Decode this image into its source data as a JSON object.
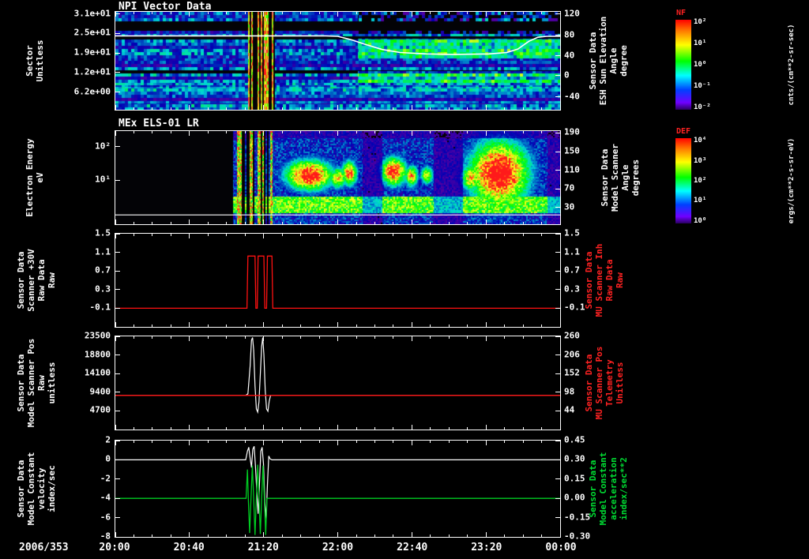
{
  "chart_data": {
    "type": "multi-panel-time-series",
    "date_label": "2006/353",
    "x_ticks": [
      "20:00",
      "20:40",
      "21:20",
      "22:00",
      "22:40",
      "23:20",
      "00:00"
    ],
    "panels": [
      {
        "title": "NPI Vector Data",
        "type": "spectrogram",
        "left_label": "Sector\nUnitless",
        "left_ticks": {
          "labels": [
            "3.1e+01",
            "2.5e+01",
            "1.9e+01",
            "1.2e+01",
            "6.2e+00"
          ],
          "fracs": [
            0.02,
            0.22,
            0.42,
            0.62,
            0.82
          ]
        },
        "right_label": "Sensor Data\nESH Sun Elevation\nAngle\ndegree",
        "right_ticks": {
          "labels": [
            "120",
            "80",
            "40",
            "0",
            "-40"
          ],
          "fracs": [
            0.02,
            0.24,
            0.45,
            0.65,
            0.87
          ]
        },
        "colorbar": {
          "title": "NF",
          "unit": "cnts/(cm**2-sr-sec)",
          "ticks": [
            "10²",
            "10¹",
            "10⁰",
            "10⁻¹",
            "10⁻²"
          ]
        },
        "series": [
          {
            "name": "esh-sun-elevation-line",
            "color": "#ffffff",
            "w": 1.6,
            "frac": true,
            "points": [
              [
                0,
                0.245
              ],
              [
                0.47,
                0.245
              ],
              [
                0.5,
                0.25
              ],
              [
                0.53,
                0.285
              ],
              [
                0.56,
                0.33
              ],
              [
                0.6,
                0.385
              ],
              [
                0.64,
                0.415
              ],
              [
                0.7,
                0.43
              ],
              [
                0.76,
                0.435
              ],
              [
                0.84,
                0.43
              ],
              [
                0.88,
                0.415
              ],
              [
                0.905,
                0.38
              ],
              [
                0.93,
                0.3
              ],
              [
                0.95,
                0.26
              ],
              [
                0.97,
                0.25
              ],
              [
                1,
                0.25
              ]
            ]
          }
        ],
        "spectro": {
          "rows": 32,
          "row_black": 0.24,
          "base": [
            0.1,
            0.3
          ],
          "bright_band": [
            0.76,
            0.93
          ],
          "right_x0": 0.545,
          "gap": [
            0.298,
            0.358
          ],
          "note": "dark blue/purple sector rows with black stripes; bright green/white vertical streaks during scanner event ~21:10-21:25; brighter cyan bands in right half"
        }
      },
      {
        "title": "MEx ELS-01 LR",
        "type": "spectrogram",
        "left_label": "Electron Energy\neV",
        "left_ticks": {
          "labels": [
            "10²",
            "10¹"
          ],
          "fracs": [
            0.167,
            0.525
          ]
        },
        "right_label": "Sensor Data\nModel Scanner\nAngle\ndegrees",
        "right_ticks": {
          "labels": [
            "190",
            "150",
            "110",
            "70",
            "30"
          ],
          "fracs": [
            0.02,
            0.22,
            0.42,
            0.62,
            0.82
          ]
        },
        "colorbar": {
          "title": "DEF",
          "unit": "ergs/(cm**2-s-sr-eV)",
          "ticks": [
            "10⁴",
            "10³",
            "10²",
            "10¹",
            "10⁰"
          ]
        },
        "series": [
          {
            "name": "model-scanner-angle-line",
            "color": "#ffffff",
            "w": 1.2,
            "frac": true,
            "points": [
              [
                0,
                0.9
              ],
              [
                1,
                0.9
              ]
            ]
          }
        ],
        "spectro": {
          "x0": 0.263,
          "streak": [
            0.272,
            0.353
          ],
          "base": [
            0.08,
            0.3
          ],
          "low_band": [
            0.7,
            0.88,
            0.45,
            0.3
          ],
          "dim": [
            [
              0.555,
              0.6
            ],
            [
              0.715,
              0.78
            ],
            [
              0.97,
              1.0
            ]
          ],
          "blobs": [
            [
              0.435,
              0.47,
              0.055,
              0.17,
              1.05
            ],
            [
              0.5,
              0.5,
              0.02,
              0.12,
              0.8
            ],
            [
              0.525,
              0.45,
              0.018,
              0.14,
              0.9
            ],
            [
              0.625,
              0.43,
              0.03,
              0.16,
              1.0
            ],
            [
              0.665,
              0.48,
              0.015,
              0.12,
              0.85
            ],
            [
              0.7,
              0.47,
              0.015,
              0.1,
              0.75
            ],
            [
              0.8,
              0.5,
              0.025,
              0.15,
              0.8
            ],
            [
              0.862,
              0.45,
              0.07,
              0.36,
              1.1
            ]
          ],
          "note": "no data before ~20:55; rainbow vertical streaks 21:05-21:25; intense red flux blobs 10-50 eV through rest of interval; large red region 23:05-23:50"
        }
      },
      {
        "type": "line",
        "left_label": "Sensor Data\nScanner +30V\nRaw Data\nRaw",
        "left_ticks": {
          "labels": [
            "1.5",
            "1.1",
            "0.7",
            "0.3",
            "-0.1"
          ],
          "fracs": [
            0,
            0.2,
            0.4,
            0.6,
            0.8
          ]
        },
        "right_label": "Sensor Data\nMU Scanner Inh\nRaw Data\nRaw",
        "right_label_color": "#ff2222",
        "right_ticks": {
          "labels": [
            "1.5",
            "1.1",
            "0.7",
            "0.3",
            "-0.1"
          ],
          "fracs": [
            0,
            0.2,
            0.4,
            0.6,
            0.8
          ]
        },
        "ylim": [
          -0.5,
          1.5
        ],
        "series": [
          {
            "name": "mu-scanner-inh-raw-line",
            "color": "#ff1111",
            "w": 1.3,
            "points": [
              [
                0,
                -0.1
              ],
              [
                0.296,
                -0.1
              ],
              [
                0.298,
                1.02
              ],
              [
                0.314,
                1.02
              ],
              [
                0.316,
                -0.1
              ],
              [
                0.319,
                -0.1
              ],
              [
                0.321,
                1.02
              ],
              [
                0.334,
                1.02
              ],
              [
                0.336,
                -0.1
              ],
              [
                0.34,
                -0.1
              ],
              [
                0.342,
                1.02
              ],
              [
                0.352,
                1.02
              ],
              [
                0.354,
                -0.1
              ],
              [
                1,
                -0.1
              ]
            ]
          }
        ]
      },
      {
        "type": "line",
        "left_label": "Sensor Data\nModel Scanner Pos\nRaw\nunitless",
        "left_ticks": {
          "labels": [
            "23500",
            "18800",
            "14100",
            "9400",
            "4700"
          ],
          "fracs": [
            0,
            0.2,
            0.4,
            0.6,
            0.8
          ]
        },
        "right_label": "Sensor Data\nMU Scanner Pos\nTelemetry\nUnitless",
        "right_label_color": "#ff2222",
        "right_ticks": {
          "labels": [
            "260",
            "206",
            "152",
            "98",
            "44"
          ],
          "fracs": [
            0,
            0.2,
            0.4,
            0.6,
            0.8
          ]
        },
        "ylim": [
          0,
          23500
        ],
        "series": [
          {
            "name": "model-scanner-pos-raw-line",
            "color": "#ffffff",
            "w": 1.2,
            "points": [
              [
                0,
                8600
              ],
              [
                0.293,
                8600
              ],
              [
                0.298,
                9000
              ],
              [
                0.303,
                16000
              ],
              [
                0.306,
                22500
              ],
              [
                0.3085,
                23200
              ],
              [
                0.311,
                20000
              ],
              [
                0.314,
                11000
              ],
              [
                0.317,
                5200
              ],
              [
                0.32,
                4400
              ],
              [
                0.323,
                7000
              ],
              [
                0.326,
                14000
              ],
              [
                0.329,
                21000
              ],
              [
                0.3315,
                23200
              ],
              [
                0.334,
                19000
              ],
              [
                0.337,
                10000
              ],
              [
                0.34,
                5200
              ],
              [
                0.343,
                4600
              ],
              [
                0.346,
                7200
              ],
              [
                0.349,
                8600
              ],
              [
                1,
                8600
              ]
            ]
          },
          {
            "name": "mu-scanner-pos-telemetry-line",
            "color": "#ff1111",
            "w": 1.3,
            "points": [
              [
                0,
                8600
              ],
              [
                1,
                8600
              ]
            ]
          }
        ]
      },
      {
        "type": "line",
        "left_label": "Sensor Data\nModel Constant\nvelocity\nindex/sec",
        "left_ticks": {
          "labels": [
            "2",
            "0",
            "-2",
            "-4",
            "-6",
            "-8"
          ],
          "fracs": [
            0,
            0.2,
            0.4,
            0.6,
            0.8,
            1.0
          ]
        },
        "right_label": "Sensor Data\nModel Constant\nacceleration\nindex/sec**2",
        "right_label_color": "#00dd33",
        "right_ticks": {
          "labels": [
            "0.45",
            "0.30",
            "0.15",
            "0.00",
            "-0.15",
            "-0.30"
          ],
          "fracs": [
            0,
            0.2,
            0.4,
            0.6,
            0.8,
            1.0
          ]
        },
        "ylim": [
          -8,
          2
        ],
        "series": [
          {
            "name": "model-constant-velocity-line",
            "color": "#ffffff",
            "w": 1.2,
            "points": [
              [
                0,
                0
              ],
              [
                0.293,
                0
              ],
              [
                0.297,
                0.9
              ],
              [
                0.3,
                1.3
              ],
              [
                0.303,
                0.2
              ],
              [
                0.306,
                -0.8
              ],
              [
                0.309,
                1.1
              ],
              [
                0.312,
                1.4
              ],
              [
                0.315,
                -0.6
              ],
              [
                0.318,
                -3.2
              ],
              [
                0.321,
                -5.6
              ],
              [
                0.324,
                -2.5
              ],
              [
                0.327,
                0.9
              ],
              [
                0.33,
                1.3
              ],
              [
                0.333,
                -0.4
              ],
              [
                0.336,
                -4.4
              ],
              [
                0.339,
                -6.1
              ],
              [
                0.342,
                -2.6
              ],
              [
                0.345,
                0.4
              ],
              [
                0.348,
                0.1
              ],
              [
                0.352,
                0
              ],
              [
                1,
                0
              ]
            ]
          },
          {
            "name": "model-constant-acceleration-line",
            "color": "#00cc22",
            "w": 1.3,
            "points": [
              [
                0,
                -4
              ],
              [
                0.294,
                -4
              ],
              [
                0.297,
                -1.0
              ],
              [
                0.299,
                -4
              ],
              [
                0.302,
                -7.6
              ],
              [
                0.305,
                -4
              ],
              [
                0.308,
                -0.6
              ],
              [
                0.311,
                -4
              ],
              [
                0.314,
                -7.8
              ],
              [
                0.317,
                -4
              ],
              [
                0.32,
                -0.5
              ],
              [
                0.323,
                -4
              ],
              [
                0.326,
                -7.7
              ],
              [
                0.329,
                -4
              ],
              [
                0.332,
                -0.6
              ],
              [
                0.335,
                -4
              ],
              [
                0.338,
                -7.8
              ],
              [
                0.341,
                -4
              ],
              [
                0.344,
                -4
              ],
              [
                1,
                -4
              ]
            ]
          }
        ]
      }
    ]
  }
}
